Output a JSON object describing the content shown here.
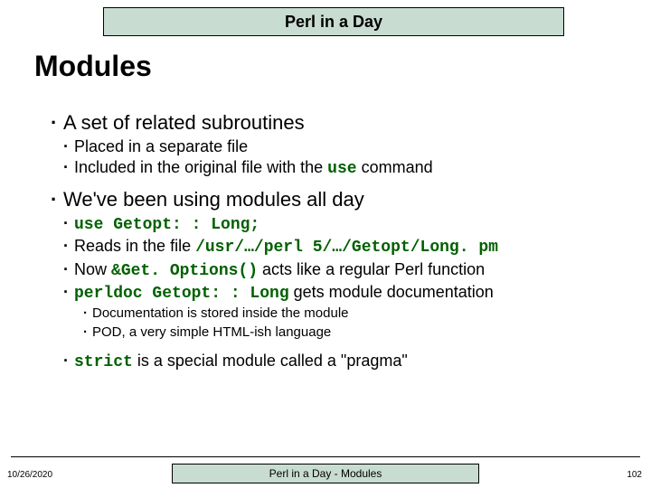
{
  "header": {
    "title": "Perl in a Day"
  },
  "slide": {
    "title": "Modules"
  },
  "b1": {
    "text": "A set of related subroutines",
    "s1": "Placed in a separate file",
    "s2a": "Included in the original file with the ",
    "s2code": "use",
    "s2b": " command"
  },
  "b2": {
    "text": "We've been using modules all day",
    "s1code": "use Getopt: : Long;",
    "s2a": "Reads in the file ",
    "s2code": "/usr/…/perl 5/…/Getopt/Long. pm",
    "s3a": "Now ",
    "s3code": "&Get. Options()",
    "s3b": " acts like a regular Perl function",
    "s4code": "perldoc Getopt: : Long",
    "s4b": " gets module documentation",
    "t1": "Documentation is stored inside the module",
    "t2": "POD, a very simple HTML-ish language"
  },
  "b3": {
    "code": "strict",
    "text": " is a special module called a \"pragma\""
  },
  "footer": {
    "date": "10/26/2020",
    "center": "Perl in a Day - Modules",
    "page": "102"
  }
}
